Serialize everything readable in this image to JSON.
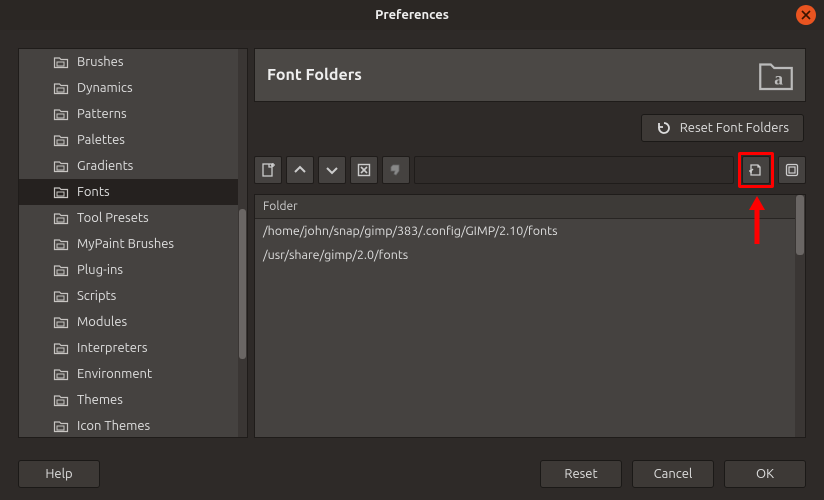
{
  "window": {
    "title": "Preferences"
  },
  "sidebar": {
    "items": [
      {
        "label": "Brushes"
      },
      {
        "label": "Dynamics"
      },
      {
        "label": "Patterns"
      },
      {
        "label": "Palettes"
      },
      {
        "label": "Gradients"
      },
      {
        "label": "Fonts",
        "selected": true
      },
      {
        "label": "Tool Presets"
      },
      {
        "label": "MyPaint Brushes"
      },
      {
        "label": "Plug-ins"
      },
      {
        "label": "Scripts"
      },
      {
        "label": "Modules"
      },
      {
        "label": "Interpreters"
      },
      {
        "label": "Environment"
      },
      {
        "label": "Themes"
      },
      {
        "label": "Icon Themes"
      }
    ]
  },
  "main": {
    "title": "Font Folders",
    "reset_btn": "Reset Font Folders",
    "path_value": "",
    "folder_header": "Folder",
    "folders": [
      "/home/john/snap/gimp/383/.config/GIMP/2.10/fonts",
      "/usr/share/gimp/2.0/fonts"
    ]
  },
  "footer": {
    "help": "Help",
    "reset": "Reset",
    "cancel": "Cancel",
    "ok": "OK"
  }
}
